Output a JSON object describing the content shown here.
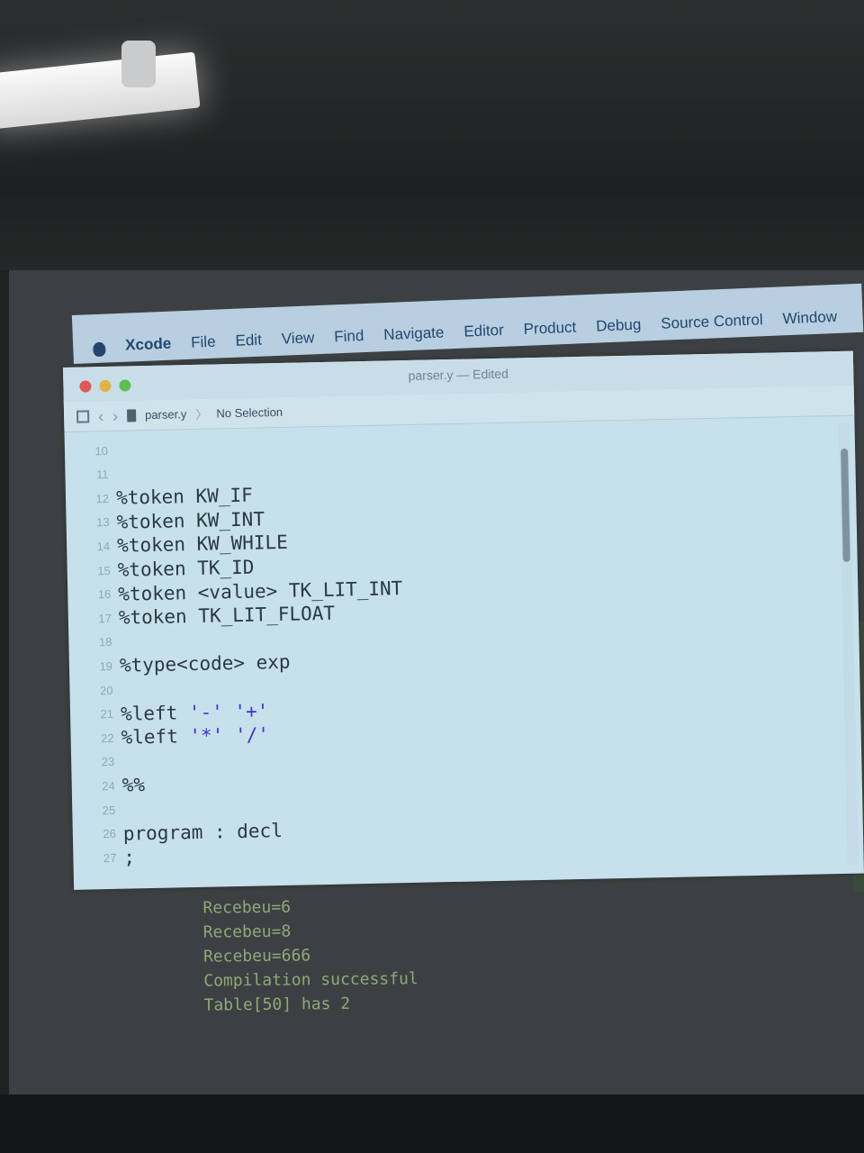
{
  "menubar": {
    "app_name": "Xcode",
    "items": [
      "File",
      "Edit",
      "View",
      "Find",
      "Navigate",
      "Editor",
      "Product",
      "Debug",
      "Source Control",
      "Window"
    ]
  },
  "window": {
    "title": "parser.y — Edited",
    "jumpbar": {
      "file": "parser.y",
      "separator": "〉",
      "selection": "No Selection"
    }
  },
  "editor": {
    "lines": [
      {
        "num": "10",
        "code": ""
      },
      {
        "num": "11",
        "code": ""
      },
      {
        "num": "12",
        "code": "%token KW_IF"
      },
      {
        "num": "13",
        "code": "%token KW_INT"
      },
      {
        "num": "14",
        "code": "%token KW_WHILE"
      },
      {
        "num": "15",
        "code": "%token TK_ID"
      },
      {
        "num": "16",
        "code": "%token <value> TK_LIT_INT"
      },
      {
        "num": "17",
        "code": "%token TK_LIT_FLOAT"
      },
      {
        "num": "18",
        "code": ""
      },
      {
        "num": "19",
        "code": "%type<code> exp"
      },
      {
        "num": "20",
        "code": ""
      },
      {
        "num": "21",
        "code": "%left '-' '+'"
      },
      {
        "num": "22",
        "code": "%left '*' '/'"
      },
      {
        "num": "23",
        "code": ""
      },
      {
        "num": "24",
        "code": "%%"
      },
      {
        "num": "25",
        "code": ""
      },
      {
        "num": "26",
        "code": "program : decl"
      },
      {
        "num": "27",
        "code": ";"
      }
    ]
  },
  "terminal": {
    "lines": [
      "Recebeu=6",
      "Recebeu=8",
      "Recebeu=666",
      "Compilation successful",
      "Table[50] has 2"
    ]
  },
  "colors": {
    "editor_bg": "#c6e0ec",
    "menubar_text": "#24466e",
    "string_literal": "#4433cc",
    "terminal_text": "#8fa87a"
  }
}
